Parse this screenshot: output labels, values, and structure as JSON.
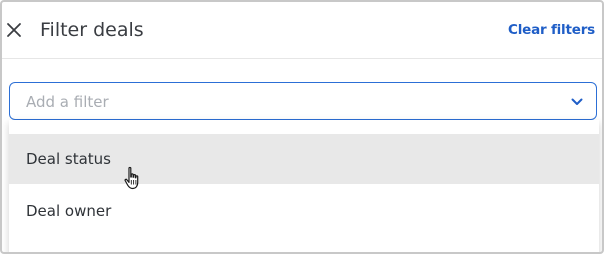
{
  "header": {
    "title": "Filter deals",
    "clear_label": "Clear filters",
    "close_icon": "close-icon"
  },
  "filter_select": {
    "placeholder": "Add a filter",
    "value": "",
    "chevron_icon": "chevron-down-icon"
  },
  "dropdown": {
    "options": [
      {
        "label": "Deal status",
        "hovered": true
      },
      {
        "label": "Deal owner",
        "hovered": false
      }
    ]
  },
  "colors": {
    "accent": "#1f5ec7",
    "select_border": "#2c6fd6",
    "hover_bg": "#e8e8e8",
    "text": "#2f3338",
    "placeholder": "#a9adb3"
  }
}
